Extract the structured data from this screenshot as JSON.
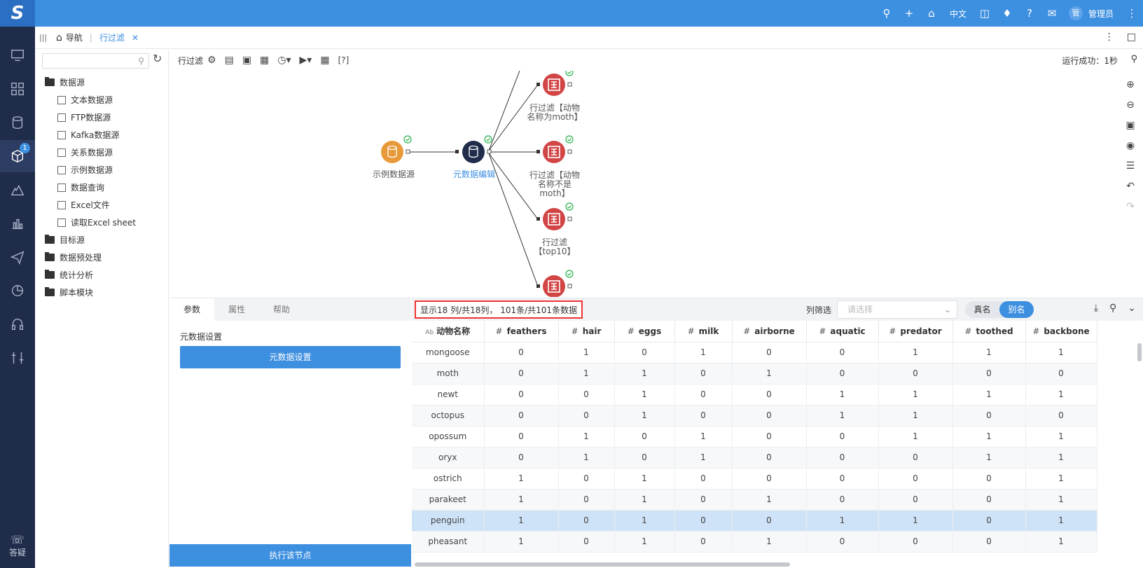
{
  "app": {
    "logo": "S"
  },
  "topbar": {
    "lang": "中文",
    "avatar": "管",
    "username": "管理员"
  },
  "nav": {
    "badge": "1",
    "help_label": "答疑"
  },
  "tabbar": {
    "home_label": "导航",
    "active_tab": "行过滤"
  },
  "tree": {
    "nodes": [
      {
        "label": "数据源",
        "type": "folder",
        "indent": 0
      },
      {
        "label": "文本数据源",
        "type": "file",
        "indent": 1
      },
      {
        "label": "FTP数据源",
        "type": "file",
        "indent": 1
      },
      {
        "label": "Kafka数据源",
        "type": "file",
        "indent": 1
      },
      {
        "label": "关系数据源",
        "type": "file",
        "indent": 1
      },
      {
        "label": "示例数据源",
        "type": "file",
        "indent": 1
      },
      {
        "label": "数据查询",
        "type": "file",
        "indent": 1
      },
      {
        "label": "Excel文件",
        "type": "file",
        "indent": 1
      },
      {
        "label": "读取Excel sheet",
        "type": "file",
        "indent": 1
      },
      {
        "label": "目标源",
        "type": "folder",
        "indent": 0
      },
      {
        "label": "数据预处理",
        "type": "folder",
        "indent": 0
      },
      {
        "label": "统计分析",
        "type": "folder",
        "indent": 0
      },
      {
        "label": "脚本模块",
        "type": "folder",
        "indent": 0
      }
    ]
  },
  "canvas_toolbar": {
    "title": "行过滤",
    "help": "[?]",
    "status": "运行成功：1秒"
  },
  "flow": {
    "source_node": "示例数据源",
    "meta_node": "元数据编辑",
    "filter_nodes": [
      {
        "line1": "行过滤【动物",
        "line2": "名称为moth】",
        "line3": ""
      },
      {
        "line1": "行过滤【动物",
        "line2": "名称不是",
        "line3": "moth】"
      },
      {
        "line1": "行过滤",
        "line2": "【top10】",
        "line3": ""
      }
    ]
  },
  "params": {
    "tabs": [
      "参数",
      "属性",
      "帮助"
    ],
    "section_label": "元数据设置",
    "settings_button": "元数据设置",
    "execute_button": "执行该节点"
  },
  "grid": {
    "info": "显示18 列/共18列， 101条/共101条数据",
    "filter_label": "列筛选",
    "filter_placeholder": "请选择",
    "toggle_real": "真名",
    "toggle_alias": "别名",
    "columns": [
      "动物名称",
      "feathers",
      "hair",
      "eggs",
      "milk",
      "airborne",
      "aquatic",
      "predator",
      "toothed",
      "backbone"
    ],
    "rows": [
      [
        "mongoose",
        "0",
        "1",
        "0",
        "1",
        "0",
        "0",
        "1",
        "1",
        "1"
      ],
      [
        "moth",
        "0",
        "1",
        "1",
        "0",
        "1",
        "0",
        "0",
        "0",
        "0"
      ],
      [
        "newt",
        "0",
        "0",
        "1",
        "0",
        "0",
        "1",
        "1",
        "1",
        "1"
      ],
      [
        "octopus",
        "0",
        "0",
        "1",
        "0",
        "0",
        "1",
        "1",
        "0",
        "0"
      ],
      [
        "opossum",
        "0",
        "1",
        "0",
        "1",
        "0",
        "0",
        "1",
        "1",
        "1"
      ],
      [
        "oryx",
        "0",
        "1",
        "0",
        "1",
        "0",
        "0",
        "0",
        "1",
        "1"
      ],
      [
        "ostrich",
        "1",
        "0",
        "1",
        "0",
        "0",
        "0",
        "0",
        "0",
        "1"
      ],
      [
        "parakeet",
        "1",
        "0",
        "1",
        "0",
        "1",
        "0",
        "0",
        "0",
        "1"
      ],
      [
        "penguin",
        "1",
        "0",
        "1",
        "0",
        "0",
        "1",
        "1",
        "0",
        "1"
      ],
      [
        "pheasant",
        "1",
        "0",
        "1",
        "0",
        "1",
        "0",
        "0",
        "0",
        "1"
      ]
    ],
    "selected_row": 8
  }
}
